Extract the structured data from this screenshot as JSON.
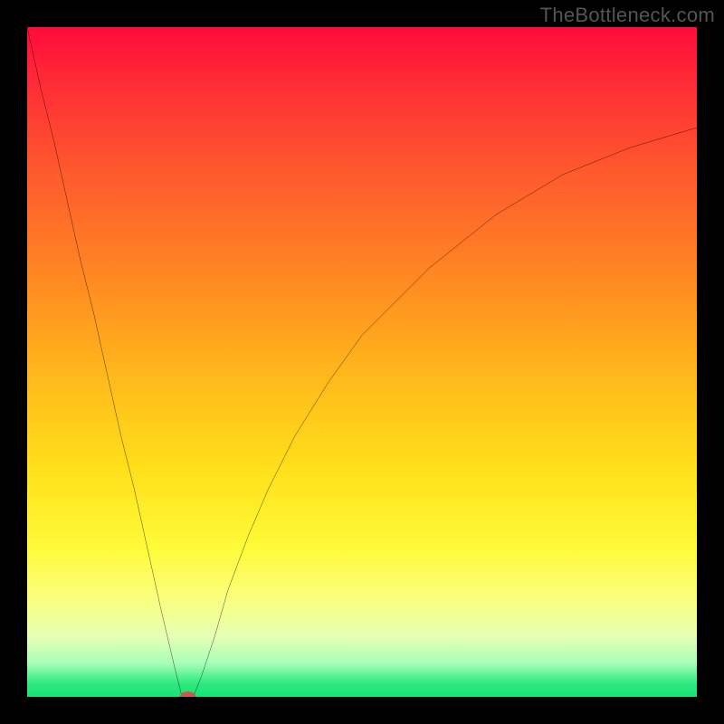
{
  "watermark": "TheBottleneck.com",
  "chart_data": {
    "type": "line",
    "title": "",
    "xlabel": "",
    "ylabel": "",
    "xlim": [
      0,
      100
    ],
    "ylim": [
      0,
      100
    ],
    "grid": false,
    "legend": false,
    "background": {
      "type": "vertical-gradient",
      "stops": [
        {
          "pos": 0.0,
          "color": "#ff0b3a"
        },
        {
          "pos": 0.08,
          "color": "#ff2a36"
        },
        {
          "pos": 0.22,
          "color": "#ff5a2d"
        },
        {
          "pos": 0.38,
          "color": "#ff8a22"
        },
        {
          "pos": 0.52,
          "color": "#ffb81b"
        },
        {
          "pos": 0.66,
          "color": "#ffe019"
        },
        {
          "pos": 0.78,
          "color": "#fffb3a"
        },
        {
          "pos": 0.86,
          "color": "#f8ff84"
        },
        {
          "pos": 0.91,
          "color": "#e6ffb4"
        },
        {
          "pos": 0.95,
          "color": "#a6ffb8"
        },
        {
          "pos": 0.98,
          "color": "#2de97f"
        },
        {
          "pos": 1.0,
          "color": "#18e278"
        }
      ]
    },
    "series": [
      {
        "name": "bottleneck-curve",
        "color": "#000000",
        "x": [
          0,
          2,
          4,
          6,
          8,
          10,
          12,
          14,
          16,
          18,
          20,
          22,
          23,
          24,
          25,
          26,
          28,
          30,
          33,
          36,
          40,
          45,
          50,
          55,
          60,
          65,
          70,
          75,
          80,
          85,
          90,
          95,
          100
        ],
        "y": [
          100,
          91,
          83,
          74,
          65,
          57,
          48,
          39,
          31,
          22,
          13,
          4.5,
          0.5,
          0,
          0.5,
          3,
          9,
          16,
          24,
          31,
          39,
          47,
          54,
          59,
          64,
          68,
          72,
          75,
          78,
          80,
          82,
          83.5,
          85
        ]
      }
    ],
    "marker": {
      "name": "optimal-point",
      "x": 24,
      "y": 0,
      "color": "#c95b4a",
      "rx": 1.2,
      "ry": 0.8
    }
  }
}
